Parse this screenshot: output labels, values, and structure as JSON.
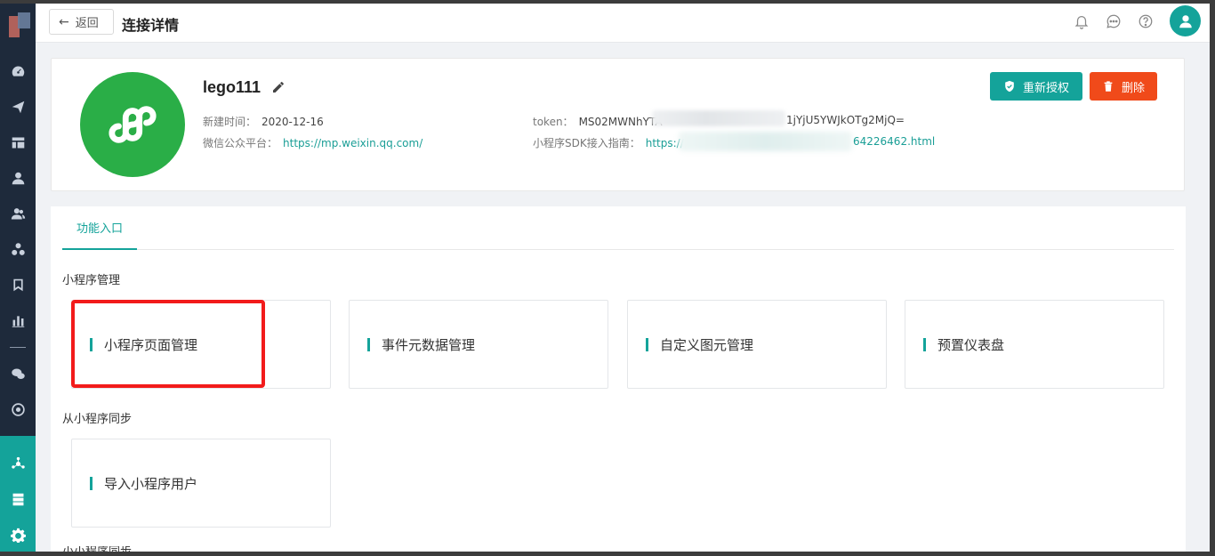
{
  "header": {
    "back_label": "返回",
    "title": "连接详情",
    "icons": [
      "bell-icon",
      "chat-icon",
      "help-icon",
      "user-avatar-icon"
    ]
  },
  "sidebar": {
    "icons": [
      "dashboard-icon",
      "send-icon",
      "layout-icon",
      "user-icon",
      "users-icon",
      "cluster-icon",
      "bookmark-icon",
      "bar-chart-icon",
      "wechat-icon",
      "target-icon",
      "network-icon",
      "server-icon",
      "settings-icon"
    ],
    "active_color": "#14a39a"
  },
  "app": {
    "name": "lego111",
    "created_label": "新建时间：",
    "created_value": "2020-12-16",
    "platform_label": "微信公众平台：",
    "platform_url": "https://mp.weixin.qq.com/",
    "token_label": "token：",
    "token_start": "MS02MWNhYTA",
    "token_end": "1jYjU5YWJkOTg2MjQ=",
    "sdk_label": "小程序SDK接入指南：",
    "sdk_url_start": "https://",
    "sdk_url_end": "64226462.html",
    "logo_color": "#2aae47"
  },
  "actions": {
    "reauth_label": "重新授权",
    "delete_label": "删除",
    "reauth_color": "#14a39a",
    "delete_color": "#f04a1a"
  },
  "tabs": [
    {
      "label": "功能入口",
      "active": true
    }
  ],
  "sections": [
    {
      "title": "小程序管理",
      "cards": [
        "小程序页面管理",
        "事件元数据管理",
        "自定义图元管理",
        "预置仪表盘"
      ]
    },
    {
      "title": "从小程序同步",
      "cards": [
        "导入小程序用户"
      ]
    },
    {
      "title": "小小程序同步"
    }
  ]
}
